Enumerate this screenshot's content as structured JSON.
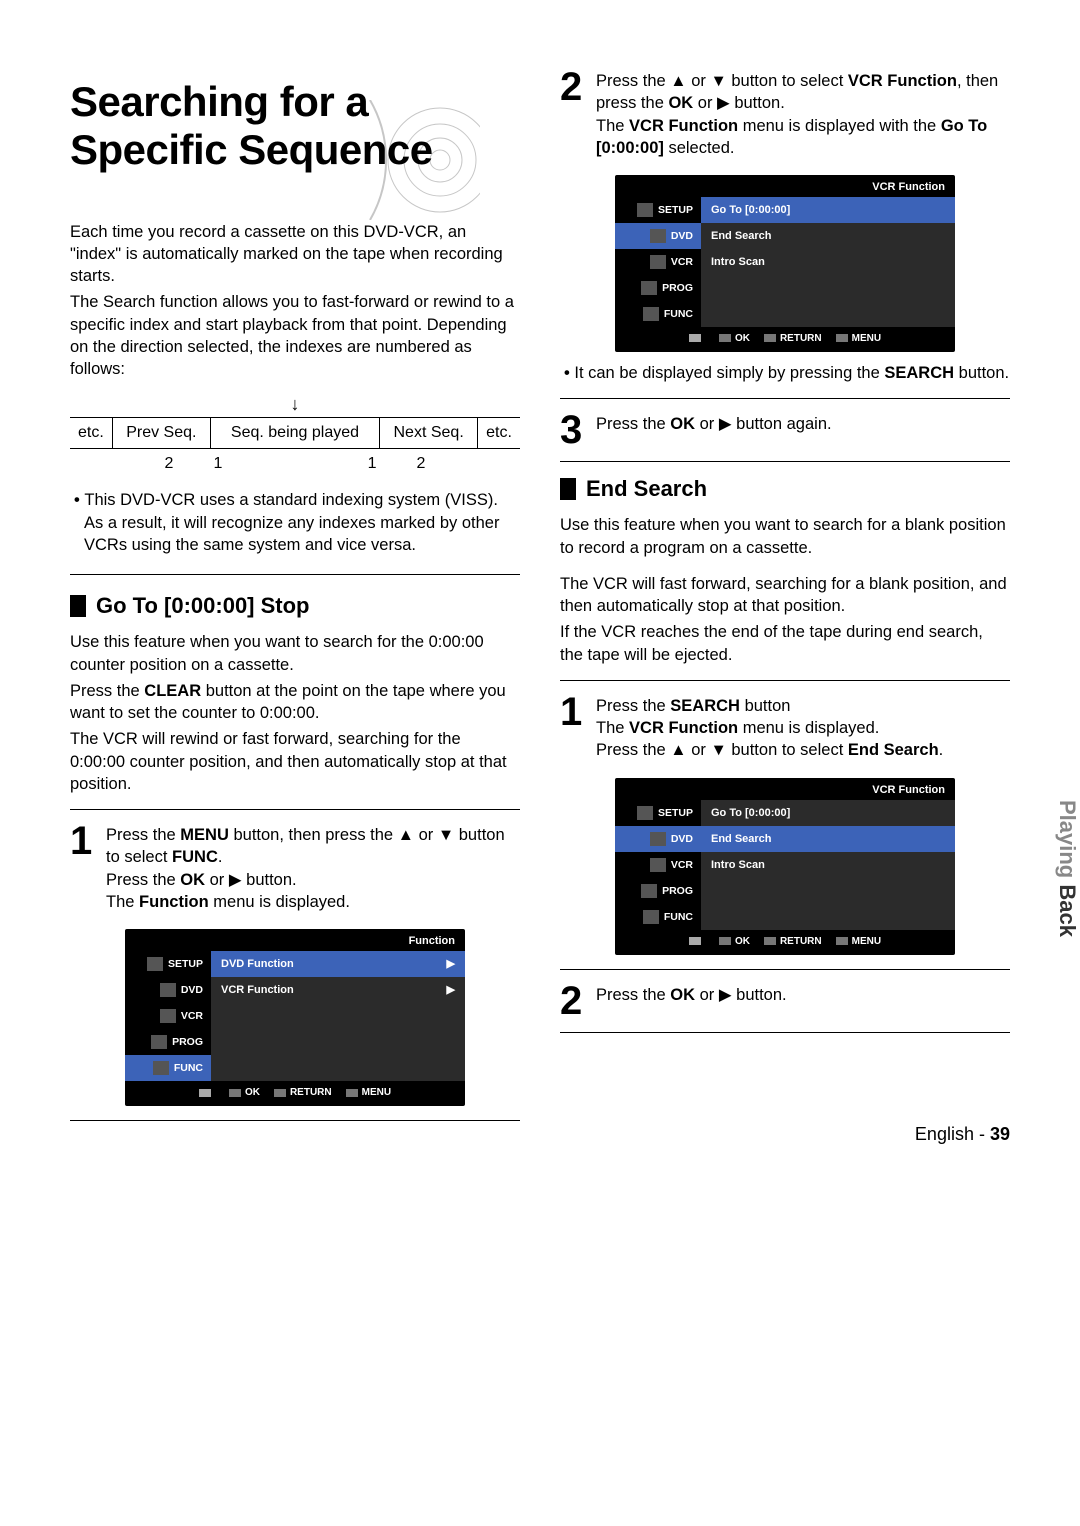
{
  "title_line1": "Searching for a",
  "title_line2": "Specific Sequence",
  "intro": {
    "p1": "Each time you record a cassette on this DVD-VCR, an \"index\" is automatically marked on the tape when recording starts.",
    "p2": "The Search function allows you to fast-forward or rewind to a specific index and start playback from that point. Depending on the direction selected, the indexes are numbered as follows:"
  },
  "seq_table": {
    "arrow": "↓",
    "cells": [
      "etc.",
      "Prev Seq.",
      "Seq. being played",
      "Next Seq.",
      "etc."
    ],
    "nums": [
      "2",
      "1",
      "1",
      "2"
    ]
  },
  "viss_note": "This DVD-VCR uses a standard indexing system (VISS). As a result, it will recognize any indexes marked by other VCRs using the same system and vice versa.",
  "goto": {
    "heading": "Go To [0:00:00] Stop",
    "p1": "Use this feature when you want to search for the 0:00:00 counter position on a cassette.",
    "p2_a": "Press the ",
    "p2_b": "CLEAR",
    "p2_c": " button at the point on the tape where you want to set the counter to 0:00:00.",
    "p3": "The VCR will rewind or fast forward, searching for the 0:00:00 counter position, and then automatically stop at that position.",
    "step1_a": "Press the ",
    "step1_menu": "MENU",
    "step1_b": " button, then press the ▲ or ▼ button to select ",
    "step1_func": "FUNC",
    "step1_c": ".",
    "step1_d": "Press the ",
    "step1_ok": "OK",
    "step1_e": " or ▶ button.",
    "step1_f": "The ",
    "step1_fn": "Function",
    "step1_g": " menu is displayed."
  },
  "step2": {
    "a": "Press the ▲ or ▼ button to select ",
    "vcrfn": "VCR Function",
    "b": ", then press the ",
    "ok": "OK",
    "c": " or ▶ button.",
    "d": "The ",
    "vcrfn2": "VCR Function",
    "e": " menu is displayed with the ",
    "goto": "Go To [0:00:00]",
    "f": " selected."
  },
  "step2_note_a": "It can be displayed simply by pressing the ",
  "step2_note_b": "SEARCH",
  "step2_note_c": " button.",
  "step3_a": "Press the ",
  "step3_ok": "OK",
  "step3_b": " or ▶ button again.",
  "end": {
    "heading": "End Search",
    "p1": "Use this feature when you want to search for a blank position to record a program on a cassette.",
    "p2": "The VCR will fast forward, searching for a blank position, and then automatically stop at that position.",
    "p3": "If the VCR reaches the end of the tape during end search, the tape will be ejected.",
    "s1_a": "Press the ",
    "s1_search": "SEARCH",
    "s1_b": " button",
    "s1_c": "The ",
    "s1_vcrfn": "VCR Function",
    "s1_d": " menu is displayed.",
    "s1_e": "Press the ▲ or ▼ button to select ",
    "s1_end": "End Search",
    "s1_f": ".",
    "s2_a": "Press the ",
    "s2_ok": "OK",
    "s2_b": " or ▶ button."
  },
  "osd": {
    "side": [
      "SETUP",
      "DVD",
      "VCR",
      "PROG",
      "FUNC"
    ],
    "foot": [
      "OK",
      "RETURN",
      "MENU"
    ],
    "panel1": {
      "title": "Function",
      "rows": [
        "DVD Function",
        "VCR Function"
      ],
      "highlight": 0
    },
    "panel2": {
      "title": "VCR Function",
      "rows": [
        "Go To [0:00:00]",
        "End Search",
        "Intro Scan"
      ],
      "highlight": 0
    },
    "panel3": {
      "title": "VCR Function",
      "rows": [
        "Go To [0:00:00]",
        "End Search",
        "Intro Scan"
      ],
      "highlight": 1
    }
  },
  "side_tab_a": "Playing ",
  "side_tab_b": "Back",
  "footer_lang": "English",
  "footer_page": "39"
}
